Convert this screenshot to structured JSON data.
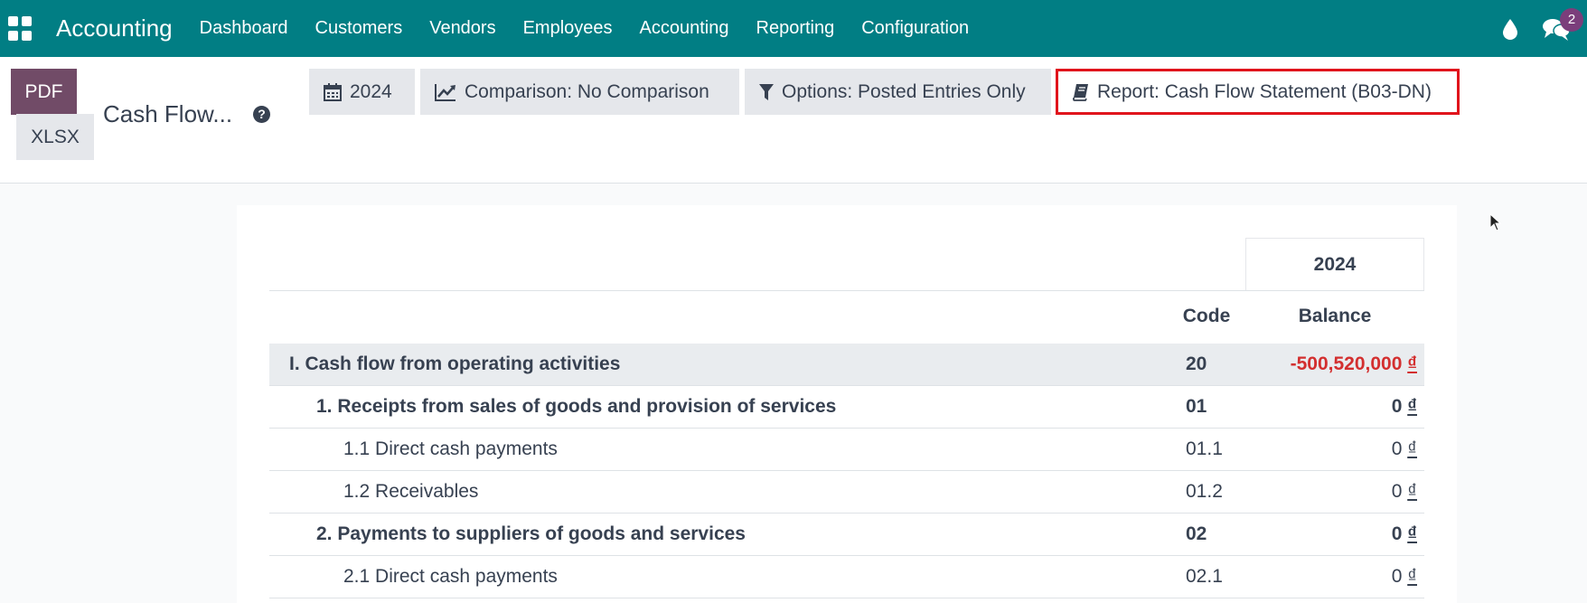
{
  "navbar": {
    "brand": "Accounting",
    "menu": [
      "Dashboard",
      "Customers",
      "Vendors",
      "Employees",
      "Accounting",
      "Reporting",
      "Configuration"
    ],
    "chat_badge": "2",
    "bar_color": "#017e84"
  },
  "control": {
    "pdf_label": "PDF",
    "xlsx_label": "XLSX",
    "title": "Cash Flow...",
    "help_symbol": "?",
    "filters": {
      "year": "2024",
      "comparison": "Comparison: No Comparison",
      "options": "Options: Posted Entries Only",
      "report": "Report: Cash Flow Statement (B03-DN)"
    }
  },
  "report": {
    "period_header": "2024",
    "columns": {
      "code": "Code",
      "balance": "Balance"
    },
    "currency": "₫",
    "rows": [
      {
        "name": "I. Cash flow from operating activities",
        "code": "20",
        "balance": "-500,520,000",
        "level": 0,
        "bold": true,
        "section": true,
        "negative": true
      },
      {
        "name": "1. Receipts from sales of goods and provision of services",
        "code": "01",
        "balance": "0",
        "level": 1,
        "bold": true,
        "section": false,
        "negative": false
      },
      {
        "name": "1.1 Direct cash payments",
        "code": "01.1",
        "balance": "0",
        "level": 2,
        "bold": false,
        "section": false,
        "negative": false
      },
      {
        "name": "1.2 Receivables",
        "code": "01.2",
        "balance": "0",
        "level": 2,
        "bold": false,
        "section": false,
        "negative": false
      },
      {
        "name": "2. Payments to suppliers of goods and services",
        "code": "02",
        "balance": "0",
        "level": 1,
        "bold": true,
        "section": false,
        "negative": false
      },
      {
        "name": "2.1 Direct cash payments",
        "code": "02.1",
        "balance": "0",
        "level": 2,
        "bold": false,
        "section": false,
        "negative": false
      }
    ]
  }
}
